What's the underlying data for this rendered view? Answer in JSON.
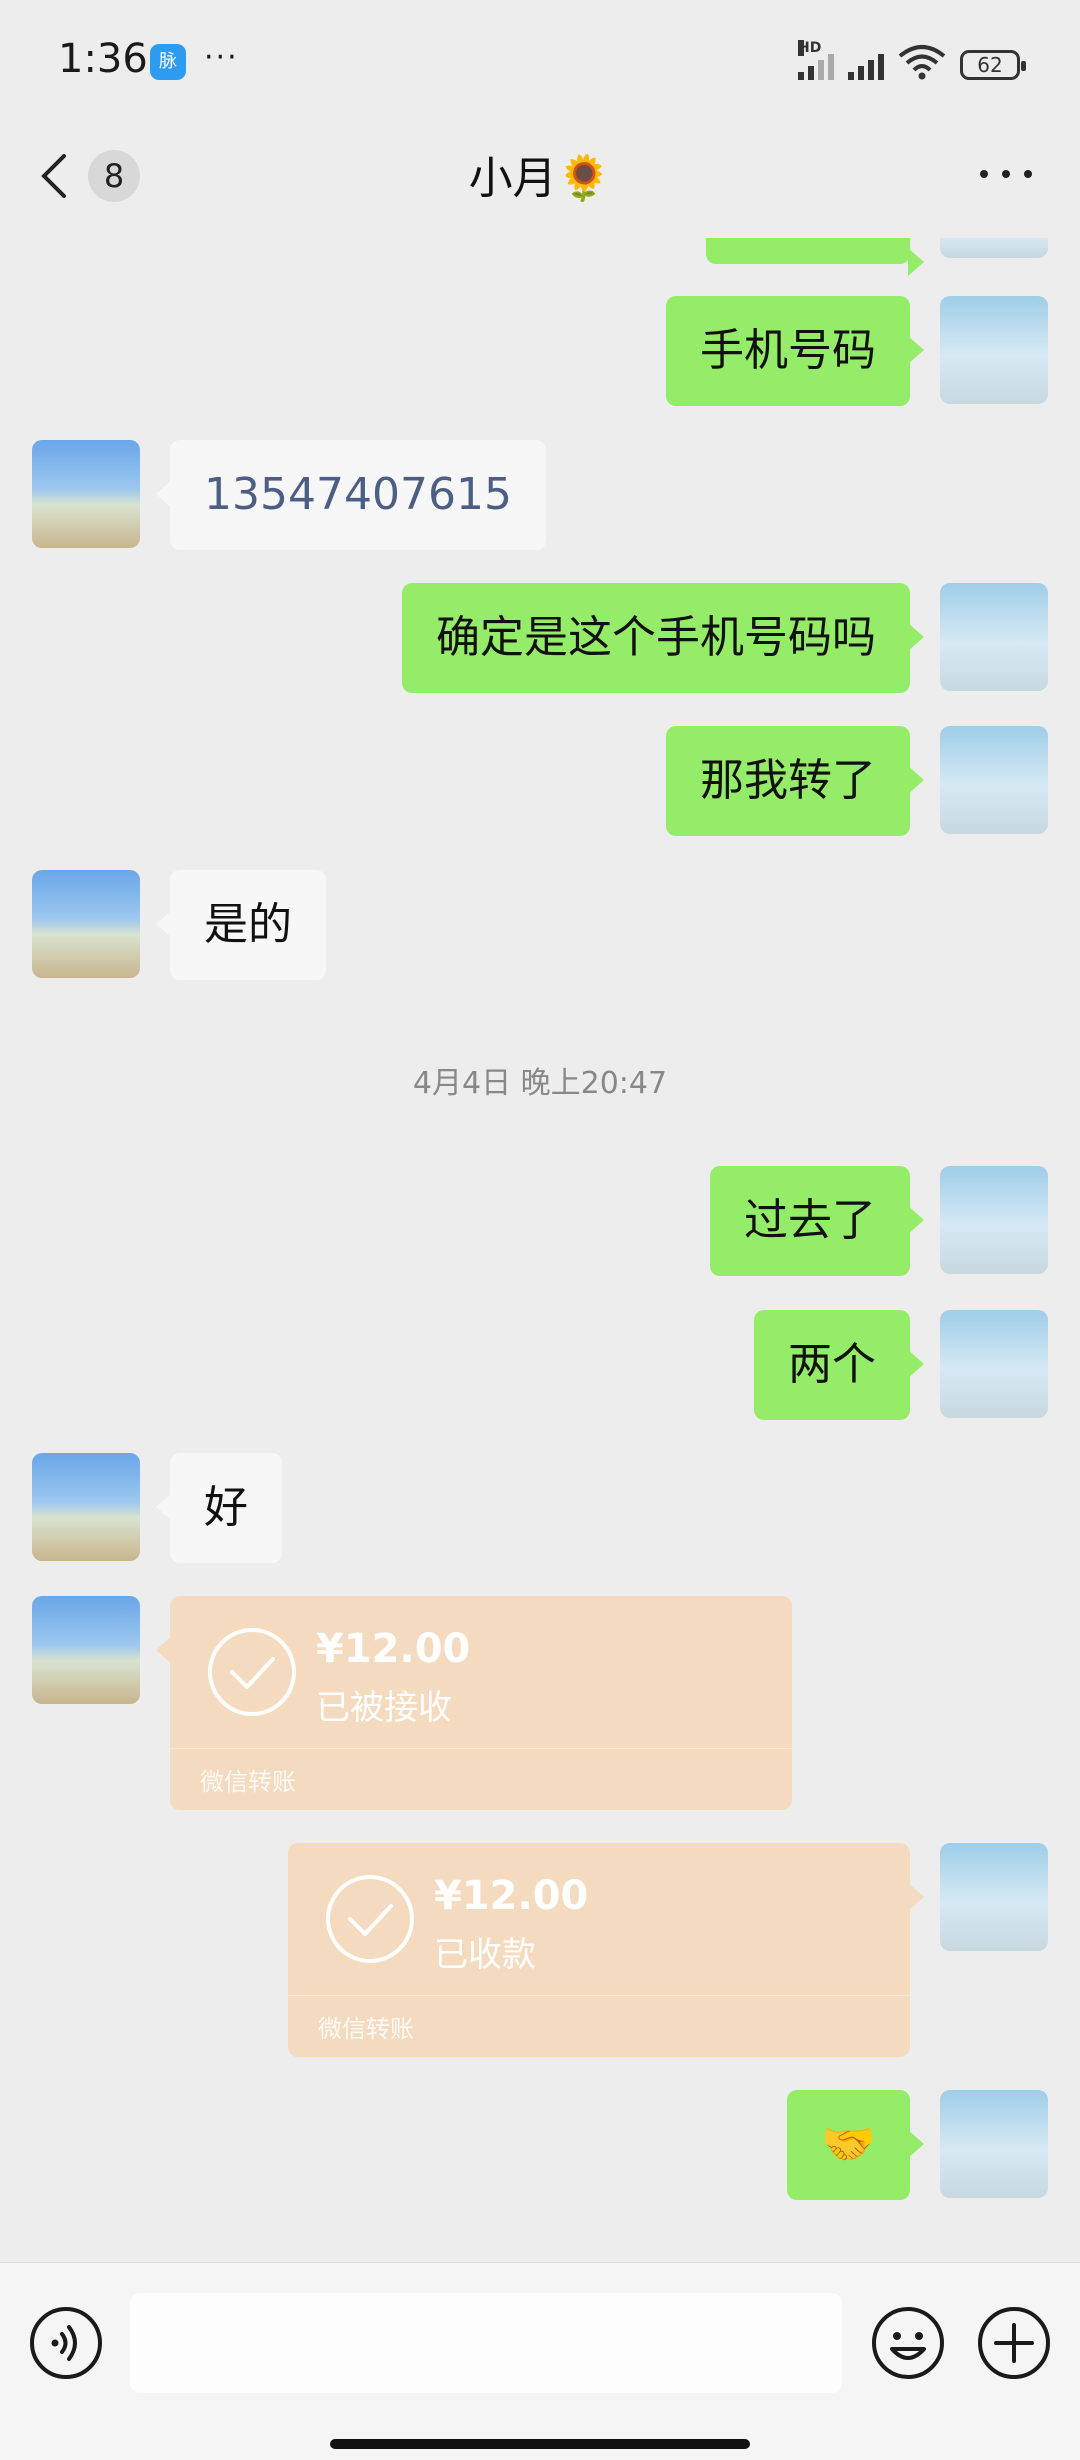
{
  "status_bar": {
    "time": "1:36",
    "app_badge": "脉",
    "dots": "···",
    "hd": "HD",
    "battery": "62"
  },
  "header": {
    "back_count": "8",
    "title": "小月🌻",
    "icons": [
      "back-chevron-icon",
      "more-dots-icon"
    ]
  },
  "messages": [
    {
      "side": "right",
      "type": "text",
      "text": "手机号码"
    },
    {
      "side": "left",
      "type": "text",
      "text": "13547407615"
    },
    {
      "side": "right",
      "type": "text",
      "text": "确定是这个手机号码吗"
    },
    {
      "side": "right",
      "type": "text",
      "text": "那我转了"
    },
    {
      "side": "left",
      "type": "text",
      "text": "是的"
    },
    {
      "type": "timestamp",
      "text": "4月4日 晚上20:47"
    },
    {
      "side": "right",
      "type": "text",
      "text": "过去了"
    },
    {
      "side": "right",
      "type": "text",
      "text": "两个"
    },
    {
      "side": "left",
      "type": "text",
      "text": "好"
    },
    {
      "side": "left",
      "type": "transfer",
      "amount": "¥12.00",
      "status": "已被接收",
      "label": "微信转账"
    },
    {
      "side": "right",
      "type": "transfer",
      "amount": "¥12.00",
      "status": "已收款",
      "label": "微信转账"
    },
    {
      "side": "right",
      "type": "text",
      "text": "🤝"
    }
  ],
  "input_bar": {
    "placeholder": "",
    "icons": [
      "voice-icon",
      "emoji-icon",
      "plus-icon"
    ]
  },
  "colors": {
    "background": "#ededed",
    "green_bubble": "#95ec69",
    "white_bubble": "#f7f7f7",
    "transfer_bubble": "#f4dbbf",
    "phone_link": "#4d5e84"
  }
}
